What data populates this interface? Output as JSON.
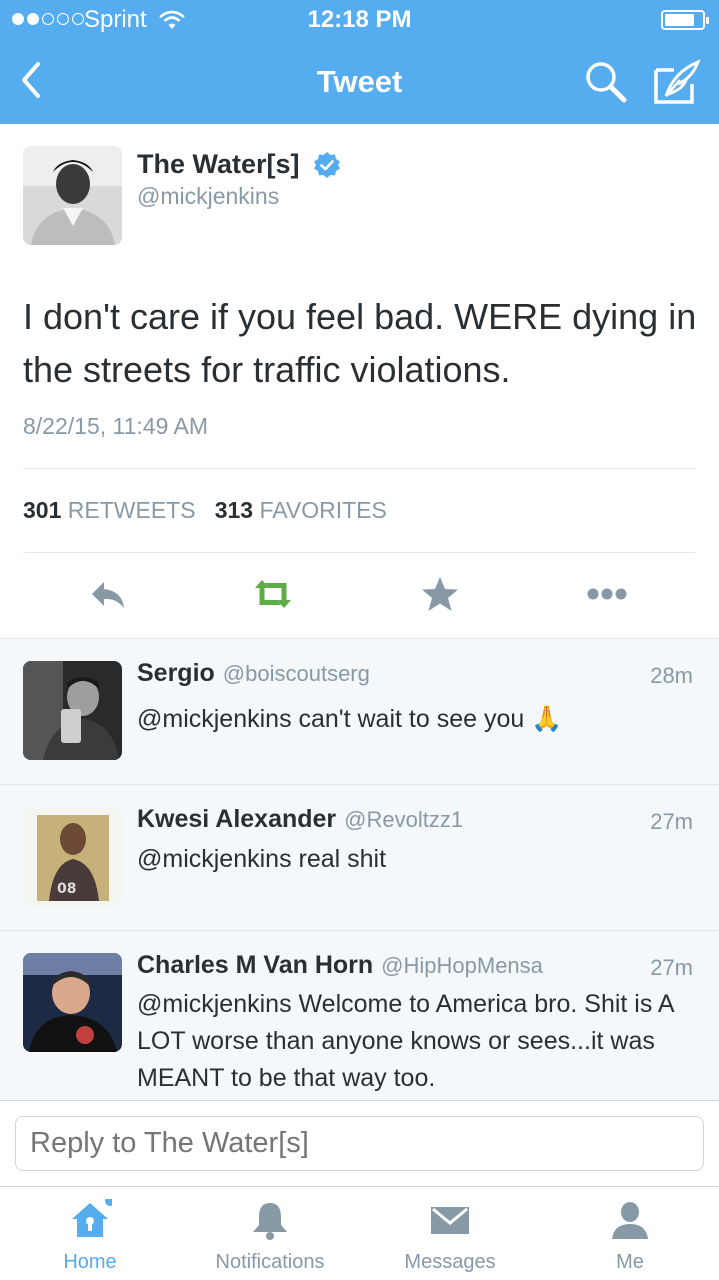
{
  "status_bar": {
    "carrier": "Sprint",
    "time": "12:18 PM",
    "battery_level": 0.8
  },
  "nav": {
    "title": "Tweet"
  },
  "tweet": {
    "name": "The Water[s]",
    "handle": "@mickjenkins",
    "text": "I don't care if you feel bad. WERE dying in the streets for traffic violations.",
    "timestamp": "8/22/15, 11:49 AM",
    "retweets_count": "301",
    "retweets_label": "RETWEETS",
    "favorites_count": "313",
    "favorites_label": "FAVORITES"
  },
  "replies": [
    {
      "name": "Sergio",
      "handle": "@boiscoutserg",
      "time": "28m",
      "text": "@mickjenkins can't wait to see you 🙏"
    },
    {
      "name": "Kwesi Alexander",
      "handle": "@Revoltzz1",
      "time": "27m",
      "text": "@mickjenkins real shit"
    },
    {
      "name": "Charles M Van Horn",
      "handle": "@HipHopMensa",
      "time": "27m",
      "text": "@mickjenkins Welcome to America bro. Shit is A LOT worse than anyone knows or sees...it was MEANT to be that way too."
    }
  ],
  "reply_box": {
    "placeholder": "Reply to The Water[s]"
  },
  "tabs": [
    {
      "label": "Home",
      "icon": "home-icon"
    },
    {
      "label": "Notifications",
      "icon": "bell-icon"
    },
    {
      "label": "Messages",
      "icon": "envelope-icon"
    },
    {
      "label": "Me",
      "icon": "person-icon"
    }
  ],
  "colors": {
    "brand": "#55acee",
    "retweet": "#5cad46",
    "muted": "#8899a6",
    "text": "#292f33"
  }
}
